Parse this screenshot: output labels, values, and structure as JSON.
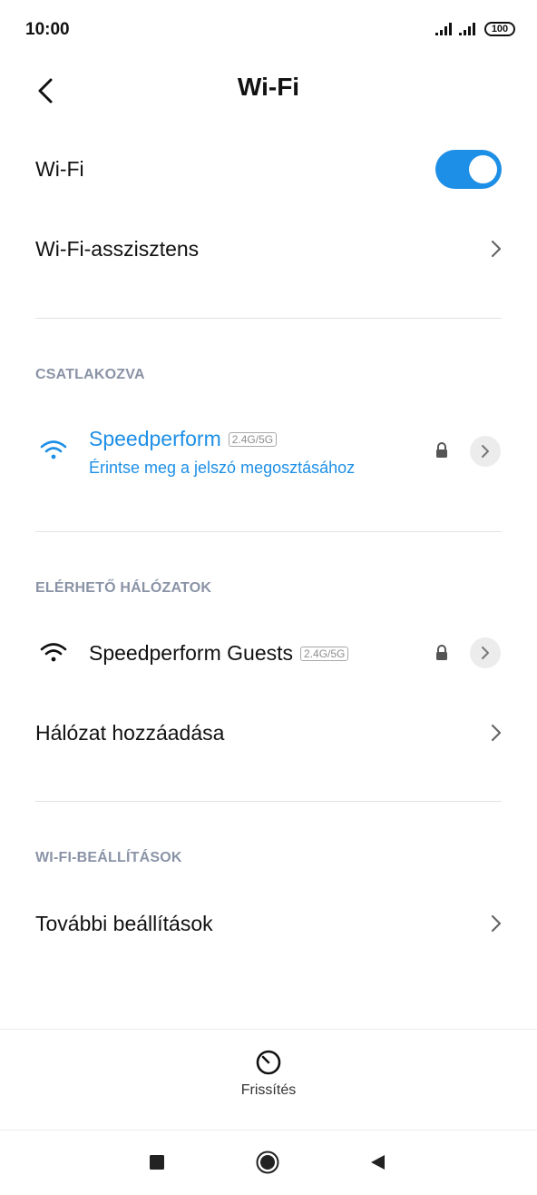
{
  "status_bar": {
    "time": "10:00",
    "battery": "100",
    "signal_icon": "signal-bars-icon"
  },
  "header": {
    "title": "Wi-Fi",
    "back_icon": "chevron-left-icon"
  },
  "wifi_toggle": {
    "label": "Wi-Fi",
    "state": "on",
    "accent": "#1e8fe6"
  },
  "assistant": {
    "label": "Wi-Fi-asszisztens"
  },
  "connected": {
    "header": "CSATLAKOZVA",
    "network": {
      "name": "Speedperform",
      "band": "2.4G/5G",
      "subtitle": "Érintse meg a jelszó megosztásához",
      "icon": "wifi-icon",
      "locked": true
    }
  },
  "available": {
    "header": "ELÉRHETŐ HÁLÓZATOK",
    "networks": [
      {
        "name": "Speedperform Guests",
        "band": "2.4G/5G",
        "icon": "wifi-icon",
        "locked": true
      }
    ],
    "add_network": "Hálózat hozzáadása"
  },
  "settings": {
    "header": "WI-FI-BEÁLLÍTÁSOK",
    "more": "További beállítások"
  },
  "bottom": {
    "refresh_label": "Frissítés",
    "refresh_icon": "refresh-icon"
  },
  "nav": {
    "recents_icon": "square-icon",
    "home_icon": "circle-icon",
    "back_icon": "triangle-back-icon"
  }
}
